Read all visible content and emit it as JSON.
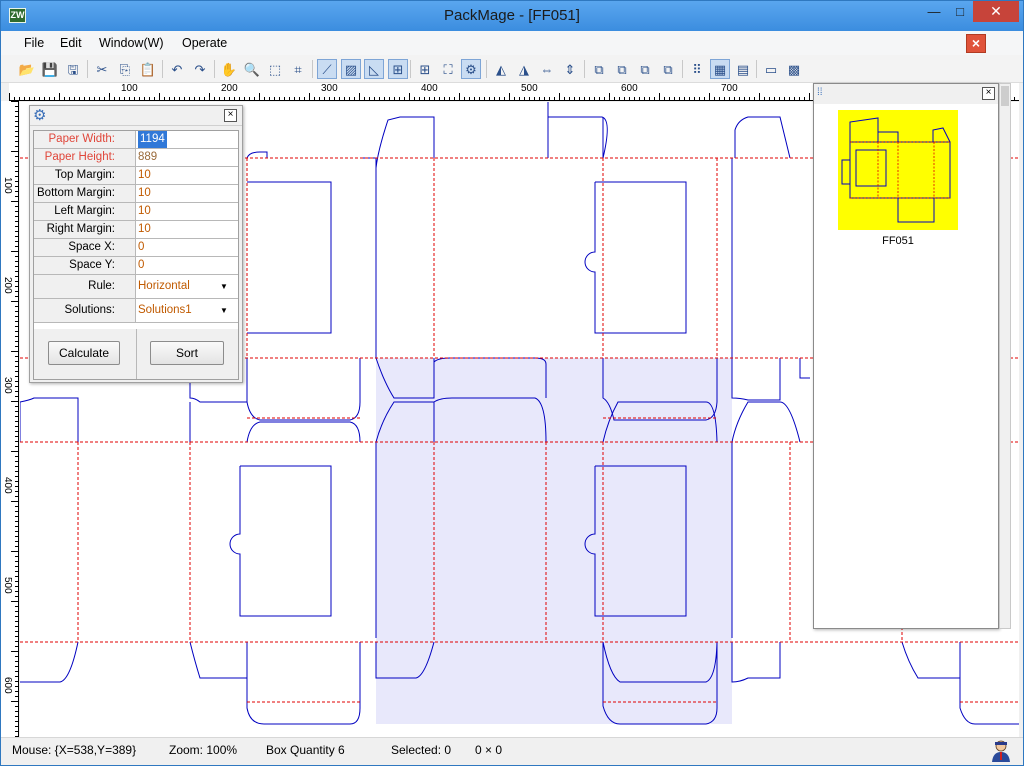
{
  "window": {
    "title": "PackMage - [FF051]",
    "icon_text": "ZW",
    "minimize_icon": "minimize-icon",
    "maximize_icon": "maximize-icon",
    "close_icon": "close-icon"
  },
  "menu": {
    "items": [
      "File",
      "Edit",
      "Window(W)",
      "Operate"
    ]
  },
  "toolbar": {
    "buttons": [
      {
        "name": "open-folder-icon",
        "glyph": "📂"
      },
      {
        "name": "save-icon",
        "glyph": "💾"
      },
      {
        "name": "save-all-icon",
        "glyph": "🖫"
      },
      {
        "name": "cut-icon",
        "glyph": "✂"
      },
      {
        "name": "copy-icon",
        "glyph": "⎘"
      },
      {
        "name": "paste-icon",
        "glyph": "📋"
      },
      {
        "name": "undo-icon",
        "glyph": "↶"
      },
      {
        "name": "redo-icon",
        "glyph": "↷"
      },
      {
        "name": "hand-pan-icon",
        "glyph": "✋"
      },
      {
        "name": "zoom-icon",
        "glyph": "🔍"
      },
      {
        "name": "select-rect-icon",
        "glyph": "⬚"
      },
      {
        "name": "crop-icon",
        "glyph": "⌗"
      },
      {
        "name": "draw-line-icon",
        "glyph": "⟋"
      },
      {
        "name": "hatch-icon",
        "glyph": "▨"
      },
      {
        "name": "triangle-fill-icon",
        "glyph": "◺"
      },
      {
        "name": "frame-icon",
        "glyph": "⊞"
      },
      {
        "name": "grid-four-icon",
        "glyph": "⊞"
      },
      {
        "name": "fit-icon",
        "glyph": "⛶"
      },
      {
        "name": "gear-icon",
        "glyph": "⚙"
      },
      {
        "name": "mirror-left-icon",
        "glyph": "◭"
      },
      {
        "name": "mirror-right-icon",
        "glyph": "◮"
      },
      {
        "name": "flip-horizontal-icon",
        "glyph": "⇔"
      },
      {
        "name": "flip-vertical-icon",
        "glyph": "⇕"
      },
      {
        "name": "align-a-icon",
        "glyph": "⧉"
      },
      {
        "name": "align-b-icon",
        "glyph": "⧉"
      },
      {
        "name": "align-c-icon",
        "glyph": "⧉"
      },
      {
        "name": "align-d-icon",
        "glyph": "⧉"
      },
      {
        "name": "layout-grid-icon",
        "glyph": "⠿"
      },
      {
        "name": "layout-active-icon",
        "glyph": "▦"
      },
      {
        "name": "table-icon",
        "glyph": "▤"
      },
      {
        "name": "window-icon",
        "glyph": "▭"
      },
      {
        "name": "palette-icon",
        "glyph": "▩"
      }
    ]
  },
  "ruler": {
    "top_labels": [
      "100",
      "200",
      "300",
      "400",
      "500",
      "600",
      "700"
    ],
    "left_labels": [
      "100",
      "200",
      "300",
      "400",
      "500",
      "600"
    ]
  },
  "properties": {
    "rows": [
      {
        "label": "Paper Width:",
        "value": "1194"
      },
      {
        "label": "Paper Height:",
        "value": "889"
      },
      {
        "label": "Top Margin:",
        "value": "10"
      },
      {
        "label": "Bottom Margin:",
        "value": "10"
      },
      {
        "label": "Left Margin:",
        "value": "10"
      },
      {
        "label": "Right Margin:",
        "value": "10"
      },
      {
        "label": "Space X:",
        "value": "0"
      },
      {
        "label": "Space Y:",
        "value": "0"
      },
      {
        "label": "Rule:",
        "value": "Horizontal"
      },
      {
        "label": "Solutions:",
        "value": "Solutions1"
      }
    ],
    "calculate_label": "Calculate",
    "sort_label": "Sort"
  },
  "preview": {
    "thumb_name": "FF051",
    "thumb_bg": "#ffff00"
  },
  "status": {
    "mouse": "Mouse:  {X=538,Y=389}",
    "zoom": "Zoom:  100%",
    "box_quantity": "Box Quantity  6",
    "selected": "Selected:  0",
    "dims": "0 × 0"
  },
  "colors": {
    "cut_line": "#0000c0",
    "fold_line": "#e00000",
    "selection": "#e8e8fb"
  }
}
